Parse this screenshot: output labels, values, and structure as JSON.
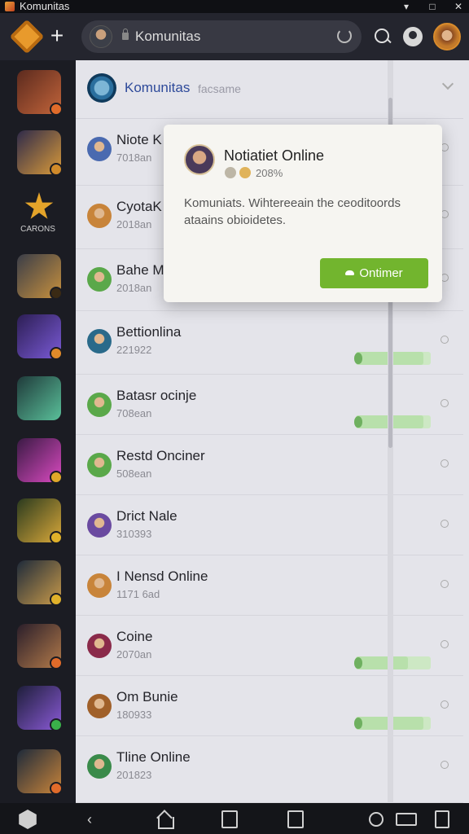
{
  "window": {
    "title": "Komunitas",
    "controls": [
      "minimize",
      "maximize",
      "close"
    ]
  },
  "topbar": {
    "search_value": "Komunitas",
    "icons": [
      "logo-icon",
      "plus-icon",
      "lock-icon",
      "reload-icon",
      "search-icon",
      "profile-icon",
      "user-avatar"
    ]
  },
  "rail": {
    "label": "CARONS",
    "items": [
      {
        "name": "game-1",
        "colors": [
          "#5b2a1e",
          "#c2643a"
        ],
        "badge": "#e06b2a"
      },
      {
        "name": "game-2",
        "colors": [
          "#2e2a4a",
          "#d99a3a"
        ],
        "badge": "#d08a2a"
      },
      {
        "name": "game-3",
        "colors": [
          "#3a3d48",
          "#c8913e"
        ],
        "badge": "#3a2a14"
      },
      {
        "name": "game-4",
        "colors": [
          "#2c1e54",
          "#7a5ad6"
        ],
        "badge": "#e08a2a"
      },
      {
        "name": "game-5",
        "colors": [
          "#1f3a3a",
          "#5ac09a"
        ],
        "badge": null
      },
      {
        "name": "game-6",
        "colors": [
          "#3a1a44",
          "#d94ac0"
        ],
        "badge": "#e0a82a"
      },
      {
        "name": "game-7",
        "colors": [
          "#2a3a1e",
          "#d9a83a"
        ],
        "badge": "#e0b12a"
      },
      {
        "name": "game-8",
        "colors": [
          "#1e2a3a",
          "#c89a4a"
        ],
        "badge": "#e0b12a"
      },
      {
        "name": "game-9",
        "colors": [
          "#2a1e2a",
          "#b27a4a"
        ],
        "badge": "#e06b2a"
      },
      {
        "name": "game-10",
        "colors": [
          "#1e1e3a",
          "#8a5ad6"
        ],
        "badge": "#3ab04a"
      },
      {
        "name": "game-11",
        "colors": [
          "#1e2a3a",
          "#c8843a"
        ],
        "badge": "#e06b2a"
      }
    ]
  },
  "content": {
    "header_title": "Komunitas",
    "header_sub": "facsame",
    "rows": [
      {
        "name": "Niote K",
        "meta": "7018an",
        "avatar": "#4a6ab0",
        "progress": null
      },
      {
        "name": "CyotaK",
        "meta": "2018an",
        "avatar": "#c8843a",
        "progress": null
      },
      {
        "name": "Bahe M",
        "meta": "2018an",
        "avatar": "#5aa84a",
        "progress": null
      },
      {
        "name": "Bettionlina",
        "meta": "221922",
        "avatar": "#2a6a8a",
        "progress": 0.9
      },
      {
        "name": "Batasr ocinje",
        "meta": "708ean",
        "avatar": "#5aa84a",
        "progress": 0.9
      },
      {
        "name": "Restd Onciner",
        "meta": "508ean",
        "avatar": "#5aa84a",
        "progress": null
      },
      {
        "name": "Drict Nale",
        "meta": "310393",
        "avatar": "#6a4aa0",
        "progress": null
      },
      {
        "name": "I Nensd Online",
        "meta": "1171 6ad",
        "avatar": "#c8843a",
        "progress": null
      },
      {
        "name": "Coine",
        "meta": "2070an",
        "avatar": "#8a2a4a",
        "progress": 0.7
      },
      {
        "name": "Om Bunie",
        "meta": "180933",
        "avatar": "#a0602a",
        "progress": 0.9
      },
      {
        "name": "Tline Online",
        "meta": "201823",
        "avatar": "#3a8a4a",
        "progress": null
      }
    ]
  },
  "popup": {
    "title": "Notiatiet Online",
    "meta": "208%",
    "body": "Komuniats. Wihtereeain the ceoditoords ataains obioidetes.",
    "button": "Ontimer"
  },
  "bottom_nav": [
    "shield-icon",
    "back-icon",
    "home-icon",
    "share-icon",
    "clipboard-icon",
    "lens-icon",
    "keyboard-icon",
    "tabs-icon"
  ]
}
